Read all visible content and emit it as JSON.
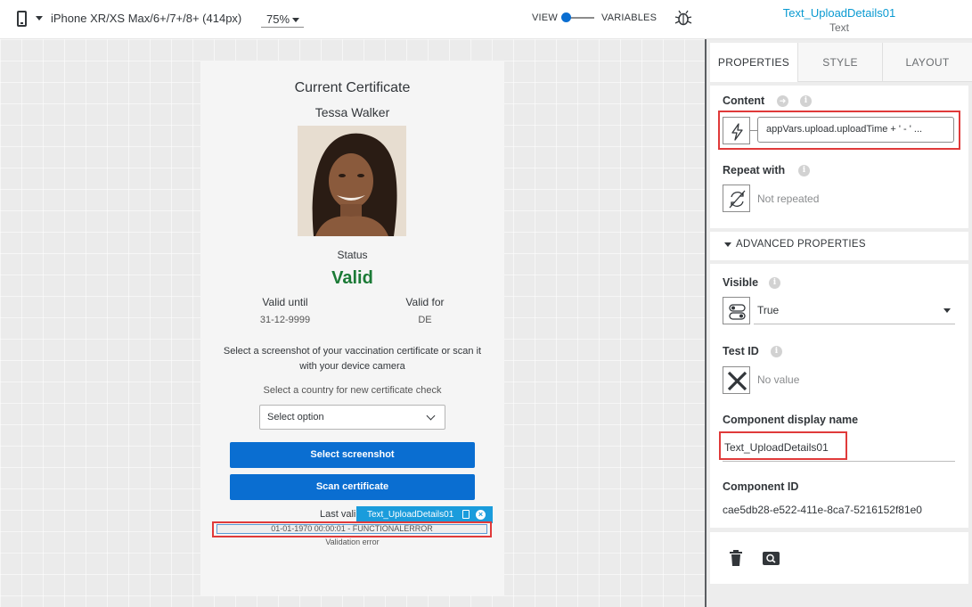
{
  "toolbar": {
    "device_label": "iPhone XR/XS Max/6+/7+/8+ (414px)",
    "zoom": "75%",
    "view_label": "VIEW",
    "variables_label": "VARIABLES",
    "toggle_state": "view",
    "selected_component_name": "Text_UploadDetails01",
    "selected_component_type": "Text"
  },
  "phone_screen": {
    "title": "Current Certificate",
    "person_name": "Tessa Walker",
    "status_label": "Status",
    "status_value": "Valid",
    "valid_until_label": "Valid until",
    "valid_until_value": "31-12-9999",
    "valid_for_label": "Valid for",
    "valid_for_value": "DE",
    "instructions": "Select a screenshot of your vaccination certificate or scan it with your device camera",
    "country_label": "Select a country for new certificate check",
    "country_select": {
      "value": "Select option"
    },
    "select_screenshot_button": "Select screenshot",
    "scan_certificate_button": "Scan certificate",
    "last_label": "Last vali",
    "selection_chip_label": "Text_UploadDetails01",
    "upload_details": "01-01-1970 00:00:01 - FUNCTIONALERROR",
    "validation_error": "Validation error"
  },
  "properties_panel": {
    "tabs": [
      {
        "label": "PROPERTIES",
        "active": true
      },
      {
        "label": "STYLE",
        "active": false
      },
      {
        "label": "LAYOUT",
        "active": false
      }
    ],
    "content": {
      "label": "Content",
      "formula": "appVars.upload.uploadTime + ' - ' ..."
    },
    "repeat_with": {
      "label": "Repeat with",
      "value": "Not repeated"
    },
    "advanced_properties_label": "ADVANCED PROPERTIES",
    "visible": {
      "label": "Visible",
      "value": "True"
    },
    "test_id": {
      "label": "Test ID",
      "value": "No value"
    },
    "component_display_name": {
      "label": "Component display name",
      "value": "Text_UploadDetails01"
    },
    "component_id": {
      "label": "Component ID",
      "value": "cae5db28-e522-411e-8ca7-5216152f81e0"
    }
  },
  "colors": {
    "accent_blue": "#0a6ed1",
    "selection_blue": "#1a9cdc",
    "valid_green": "#1b7a36",
    "highlight_red": "#e03a3a"
  }
}
